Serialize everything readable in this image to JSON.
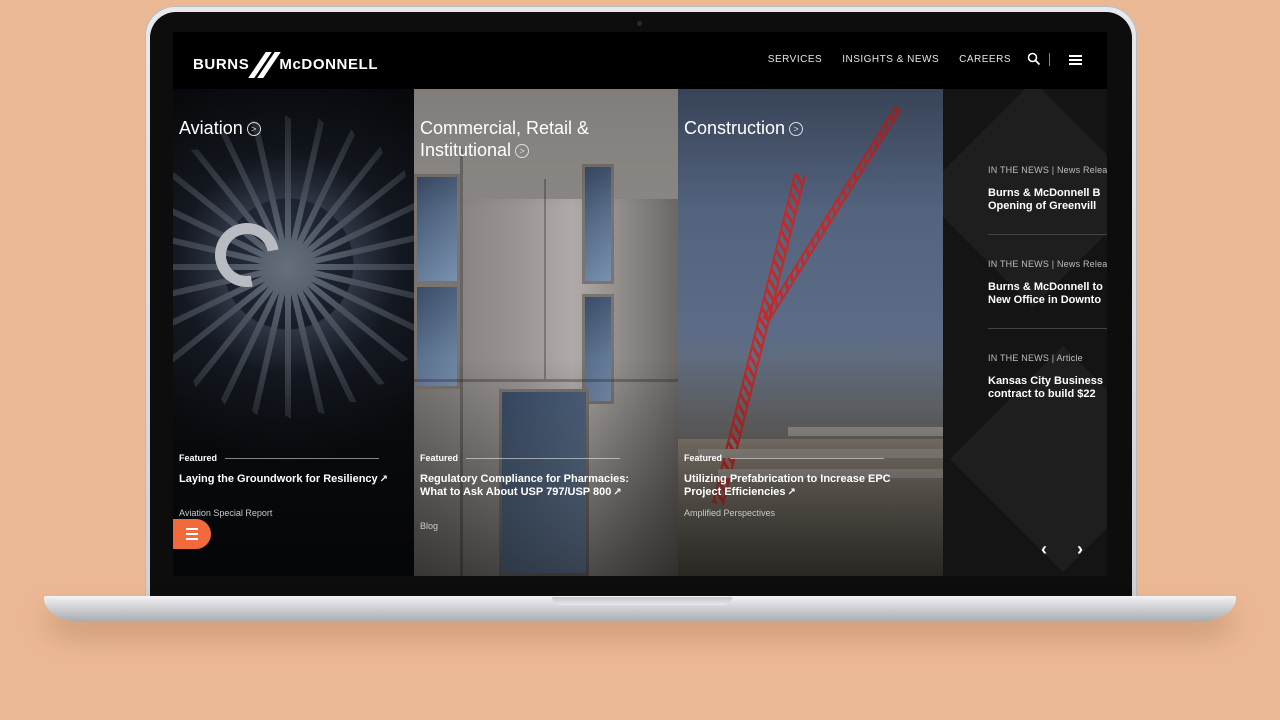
{
  "nav": {
    "logo_left": "BURNS",
    "logo_right": "McDONNELL",
    "links": [
      "SERVICES",
      "INSIGHTS & NEWS",
      "CAREERS"
    ]
  },
  "panels": [
    {
      "title": "Aviation",
      "featured_label": "Featured",
      "featured_title": "Laying the Groundwork for Resiliency",
      "source": "Aviation Special Report"
    },
    {
      "title": "Commercial, Retail & Institutional",
      "featured_label": "Featured",
      "featured_title": "Regulatory Compliance for Pharmacies: What to Ask About USP 797/USP 800",
      "source": "Blog"
    },
    {
      "title": "Construction",
      "featured_label": "Featured",
      "featured_title": "Utilizing Prefabrication to Increase EPC Project Efficiencies",
      "source": "Amplified Perspectives"
    }
  ],
  "news": [
    {
      "meta": "IN THE NEWS | News Relea",
      "title_l1": "Burns & McDonnell B",
      "title_l2": "Opening of Greenvill"
    },
    {
      "meta": "IN THE NEWS | News Relea",
      "title_l1": "Burns & McDonnell to",
      "title_l2": "New Office in Downto"
    },
    {
      "meta": "IN THE NEWS | Article",
      "title_l1": "Kansas City Business",
      "title_l2": "contract to build $22"
    }
  ],
  "colors": {
    "accent": "#f06a3c",
    "crane": "#c22a2a",
    "nav_bg": "#000000"
  }
}
